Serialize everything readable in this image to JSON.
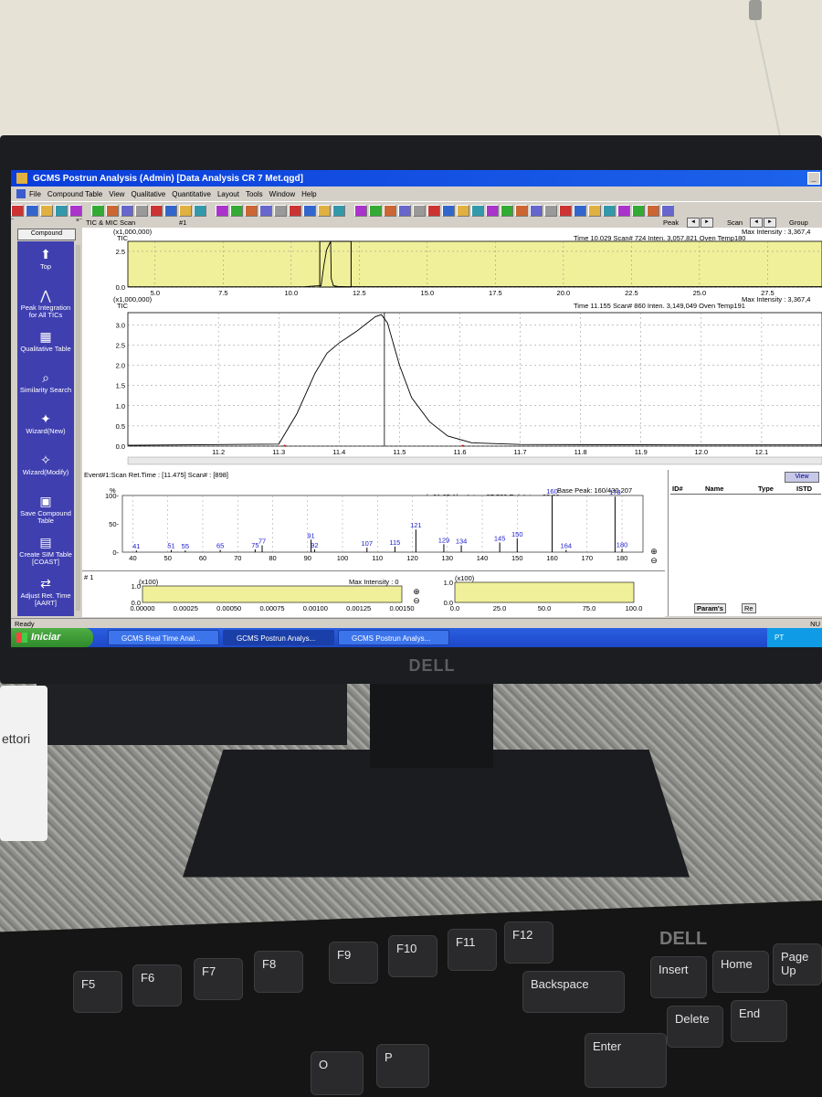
{
  "window": {
    "title": "GCMS Postrun Analysis (Admin)  [Data Analysis  CR 7 Met.qgd]"
  },
  "menu": [
    "File",
    "Compound Table",
    "View",
    "Qualitative",
    "Quantitative",
    "Layout",
    "Tools",
    "Window",
    "Help"
  ],
  "sidebar": {
    "tab": "Compound",
    "items": [
      {
        "label": "Top",
        "icon": "up-arrow-icon"
      },
      {
        "label": "Peak Integration for All TICs",
        "icon": "peak-integration-icon"
      },
      {
        "label": "Qualitative Table",
        "icon": "qualitative-table-icon"
      },
      {
        "label": "Similarity Search",
        "icon": "similarity-search-icon"
      },
      {
        "label": "Wizard(New)",
        "icon": "wizard-new-icon"
      },
      {
        "label": "Wizard(Modify)",
        "icon": "wizard-modify-icon"
      },
      {
        "label": "Save Compound Table",
        "icon": "save-table-icon"
      },
      {
        "label": "Create SIM Table [COAST]",
        "icon": "sim-table-icon"
      },
      {
        "label": "Adjust Ret. Time [AART]",
        "icon": "adjust-rt-icon"
      }
    ]
  },
  "tic_header": {
    "title": "TIC & MIC  Scan",
    "index": "#1",
    "peak_label": "Peak",
    "scan_label": "Scan",
    "group_label": "Group"
  },
  "overview": {
    "multiplier": "(x1,000,000)",
    "series": "TIC",
    "max_intensity": "Max Intensity : 3,367,4",
    "info": "Time  10.029   Scan#   724   Inten.        3,057,821   Oven Temp180"
  },
  "detail": {
    "multiplier": "(x1,000,000)",
    "series": "TIC",
    "max_intensity": "Max Intensity : 3,367,4",
    "info": "Time  11.155   Scan#   860   Inten.        3,149,049   Oven Temp191"
  },
  "event": {
    "header": "Event#1:Scan  Ret.Time : [11.475]   Scan# : [898]",
    "pct": "%",
    "base_peak": "Base Peak: 160/430,207",
    "readout": "m/z      91.05    Abs. Inten.          97,500    Rel. Inten.     22.66"
  },
  "id_panel": {
    "view_button": "View",
    "columns": [
      "ID#",
      "Name",
      "Type",
      "ISTD"
    ],
    "tabs": [
      "Param's",
      "Re"
    ]
  },
  "bottom": {
    "index": "#  1",
    "left_multiplier": "(x100)",
    "left_max": "Max Intensity :    0",
    "right_multiplier": "(x100)"
  },
  "status": "Ready",
  "status_right": "NU",
  "taskbar": {
    "start": "Iniciar",
    "items": [
      "GCMS Real Time Anal...",
      "GCMS Postrun Analys...",
      "GCMS Postrun Analys..."
    ],
    "lang": "PT"
  },
  "hardware": {
    "monitor_logo": "DELL",
    "keyboard_logo": "DELL",
    "paper_text": "ettori",
    "keys": [
      "F5",
      "F6",
      "F7",
      "F8",
      "F9",
      "F10",
      "F11",
      "F12",
      "Backspace",
      "Insert",
      "Home",
      "Page Up",
      "Delete",
      "End",
      "Enter",
      "O",
      "P"
    ]
  },
  "chart_data": [
    {
      "type": "line",
      "title": "",
      "series_label": "TIC",
      "x": [
        4,
        9,
        10.5,
        11.1,
        11.2,
        11.3,
        11.45,
        11.47,
        11.55,
        11.7,
        12,
        15,
        20,
        25,
        29.5
      ],
      "y": [
        0.02,
        0.02,
        0.03,
        0.1,
        1.5,
        2.6,
        3.2,
        0.6,
        0.1,
        0.04,
        0.03,
        0.03,
        0.03,
        0.03,
        0.03
      ],
      "xlim": [
        4,
        29.5
      ],
      "ylim": [
        0,
        3.2
      ],
      "xticks": [
        5.0,
        7.5,
        10.0,
        12.5,
        15.0,
        17.5,
        20.0,
        22.5,
        25.0,
        27.5
      ],
      "yticks": [
        0.0,
        2.5
      ]
    },
    {
      "type": "line",
      "title": "",
      "series_label": "TIC",
      "x": [
        11.05,
        11.3,
        11.33,
        11.36,
        11.38,
        11.4,
        11.43,
        11.46,
        11.47,
        11.48,
        11.5,
        11.52,
        11.55,
        11.58,
        11.62,
        11.7,
        12.0,
        12.2
      ],
      "y": [
        0.02,
        0.05,
        0.8,
        1.8,
        2.3,
        2.55,
        2.85,
        3.2,
        3.25,
        3.05,
        2.0,
        1.2,
        0.6,
        0.25,
        0.08,
        0.04,
        0.03,
        0.03
      ],
      "xlim": [
        11.05,
        12.2
      ],
      "ylim": [
        0,
        3.3
      ],
      "xticks": [
        11.2,
        11.3,
        11.4,
        11.5,
        11.6,
        11.7,
        11.8,
        11.9,
        12.0,
        12.1
      ],
      "yticks": [
        0.0,
        0.5,
        1.0,
        1.5,
        2.0,
        2.5,
        3.0
      ]
    },
    {
      "type": "bar",
      "title": "",
      "x": [
        41,
        51,
        55,
        65,
        75,
        77,
        91,
        92,
        107,
        115,
        121,
        129,
        134,
        145,
        150,
        160,
        164,
        178,
        180
      ],
      "values": [
        3,
        4,
        3,
        4,
        5,
        12,
        22,
        5,
        8,
        10,
        40,
        14,
        12,
        17,
        24,
        100,
        4,
        98,
        6
      ],
      "labels": [
        "41",
        "51",
        "55",
        "65",
        "75",
        "77",
        "91",
        "92",
        "107",
        "115",
        "121",
        "129",
        "134",
        "145",
        "150",
        "160",
        "164",
        "178",
        "180"
      ],
      "xlim": [
        37,
        186
      ],
      "ylim": [
        0,
        100
      ],
      "xticks": [
        40,
        50,
        60,
        70,
        80,
        90,
        100,
        110,
        120,
        130,
        140,
        150,
        160,
        170,
        180
      ],
      "yticks": [
        0,
        50,
        100
      ],
      "ylabel": "%"
    },
    {
      "type": "line",
      "title": "",
      "xticks": [
        "0.00000",
        "0.00025",
        "0.00050",
        "0.00075",
        "0.00100",
        "0.00125",
        "0.00150"
      ],
      "yticks": [
        "0.0",
        "1.0"
      ]
    },
    {
      "type": "line",
      "title": "",
      "xticks": [
        "0.0",
        "25.0",
        "50.0",
        "75.0",
        "100.0"
      ],
      "yticks": [
        "0.0",
        "1.0"
      ]
    }
  ]
}
